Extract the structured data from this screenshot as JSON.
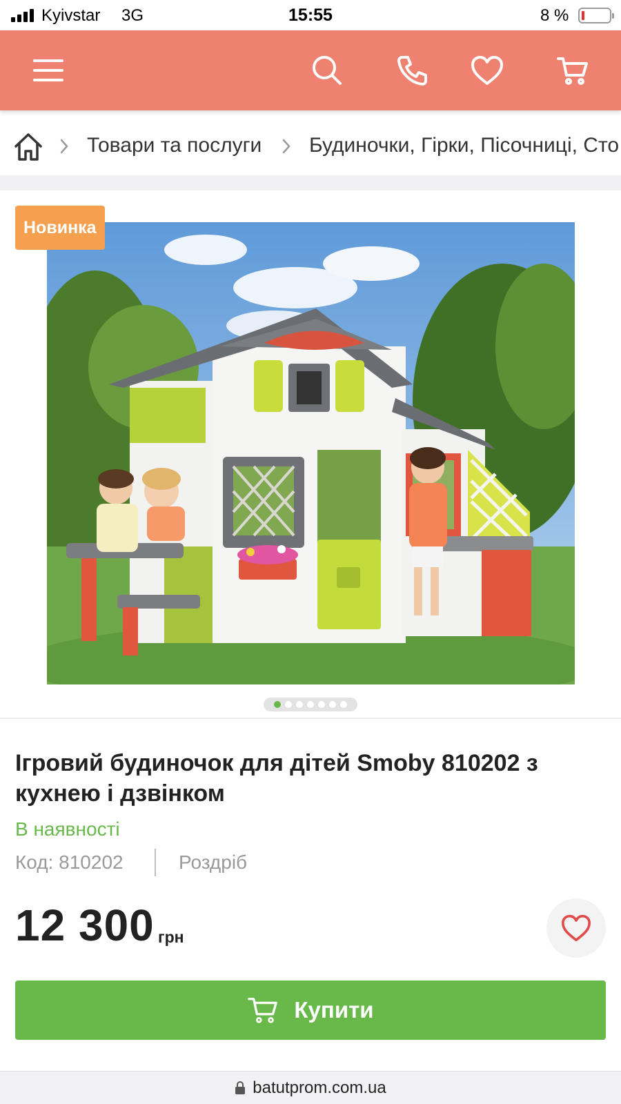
{
  "status_bar": {
    "carrier": "Kyivstar",
    "network": "3G",
    "time": "15:55",
    "battery": "8 %"
  },
  "header": {
    "icons": [
      "menu-icon",
      "search-icon",
      "phone-icon",
      "heart-icon",
      "cart-icon"
    ],
    "background_color": "#ef8170"
  },
  "breadcrumb": {
    "items": [
      "Товари та послуги",
      "Будиночки, Гірки, Пісочниці, Сто"
    ]
  },
  "gallery": {
    "badge": "Новинка",
    "badge_color": "#f4a04e",
    "slide_count": 7,
    "active_slide": 1
  },
  "product": {
    "title": "Ігровий будиночок для дітей Smoby 810202 з кухнею і дзвінком",
    "availability": "В наявності",
    "code": "Код: 810202",
    "sale_type": "Роздріб",
    "price": "12 300",
    "currency": "грн"
  },
  "buy_button": {
    "label": "Купити",
    "color": "#68b94a"
  },
  "url_bar": {
    "domain": "batutprom.com.ua"
  }
}
